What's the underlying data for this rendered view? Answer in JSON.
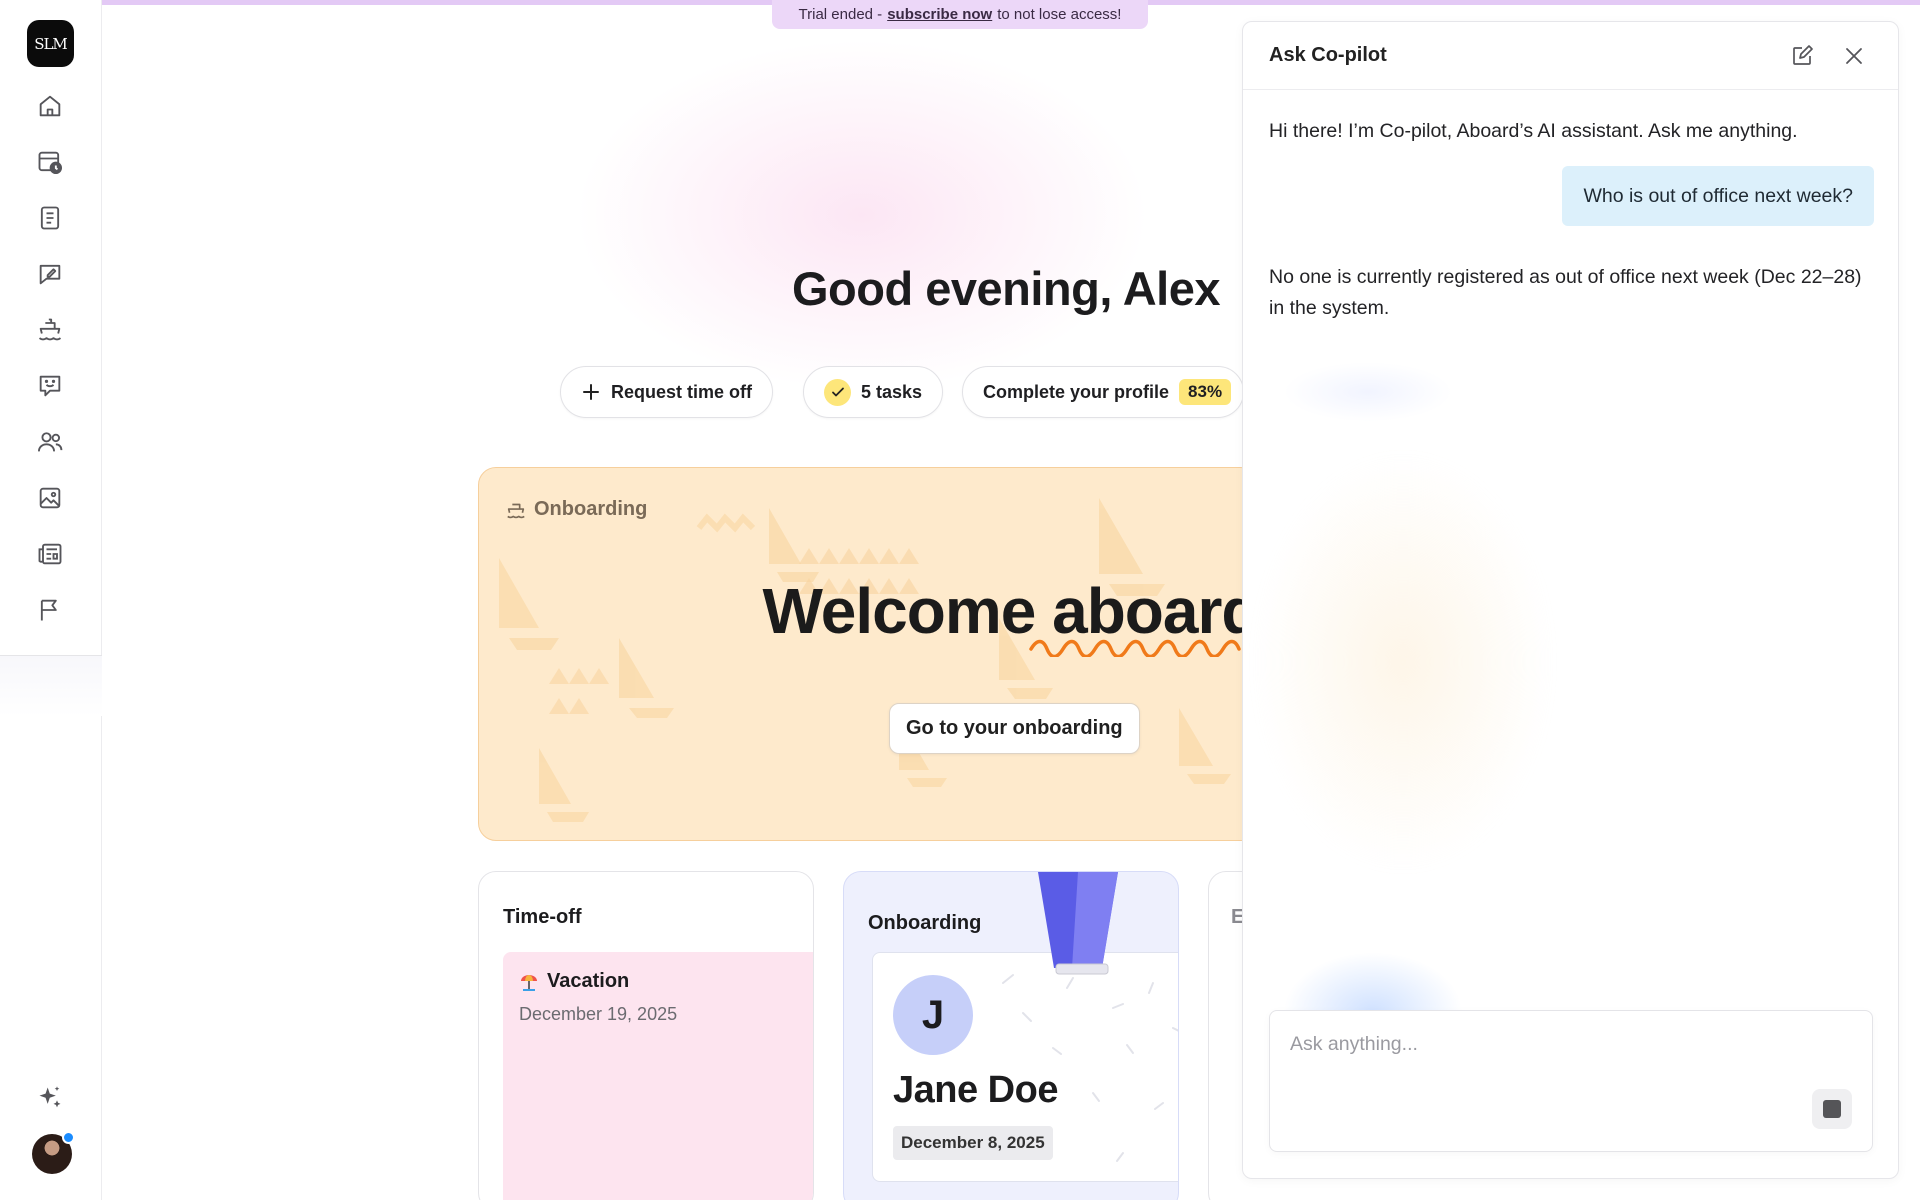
{
  "banner": {
    "prefix": "Trial ended -",
    "link": "subscribe now",
    "suffix": "to not lose access!"
  },
  "sidebar": {
    "logo_text": "SLM",
    "items": [
      {
        "name": "home",
        "icon": "home-icon"
      },
      {
        "name": "calendar",
        "icon": "calendar-clock-icon"
      },
      {
        "name": "documents",
        "icon": "document-list-icon"
      },
      {
        "name": "feedback",
        "icon": "edit-bubble-icon"
      },
      {
        "name": "onboarding",
        "icon": "ship-icon"
      },
      {
        "name": "chat",
        "icon": "smile-bubble-icon"
      },
      {
        "name": "people",
        "icon": "people-icon"
      },
      {
        "name": "media",
        "icon": "image-icon"
      },
      {
        "name": "news",
        "icon": "newspaper-icon"
      },
      {
        "name": "reports",
        "icon": "flag-icon"
      }
    ],
    "copilot_icon": "sparkle-icon"
  },
  "main": {
    "greeting": "Good evening, Alex",
    "actions": {
      "request_time_off": "Request time off",
      "tasks": "5 tasks",
      "profile": "Complete your profile",
      "profile_percent": "83%"
    },
    "hero": {
      "label": "Onboarding",
      "title": "Welcome aboard",
      "button": "Go to your onboarding"
    },
    "cards": {
      "timeoff": {
        "title": "Time-off",
        "item_title": "Vacation",
        "item_date": "December 19, 2025"
      },
      "onboarding": {
        "title": "Onboarding",
        "initial": "J",
        "name": "Jane Doe",
        "date": "December 8, 2025"
      },
      "third": {
        "title": "E"
      }
    }
  },
  "colors": {
    "hero_bg": "#feeacc",
    "accent_yellow": "#fde67a",
    "user_bubble": "#dcf0fb",
    "banner": "#ecd7f8"
  },
  "copilot": {
    "title": "Ask Co-pilot",
    "greeting": "Hi there! I’m Co-pilot, Aboard’s AI assistant. Ask me anything.",
    "user_message": "Who is out of office next week?",
    "answer": "No one is currently registered as out of office next week (Dec 22–28) in the system.",
    "input_placeholder": "Ask anything..."
  }
}
